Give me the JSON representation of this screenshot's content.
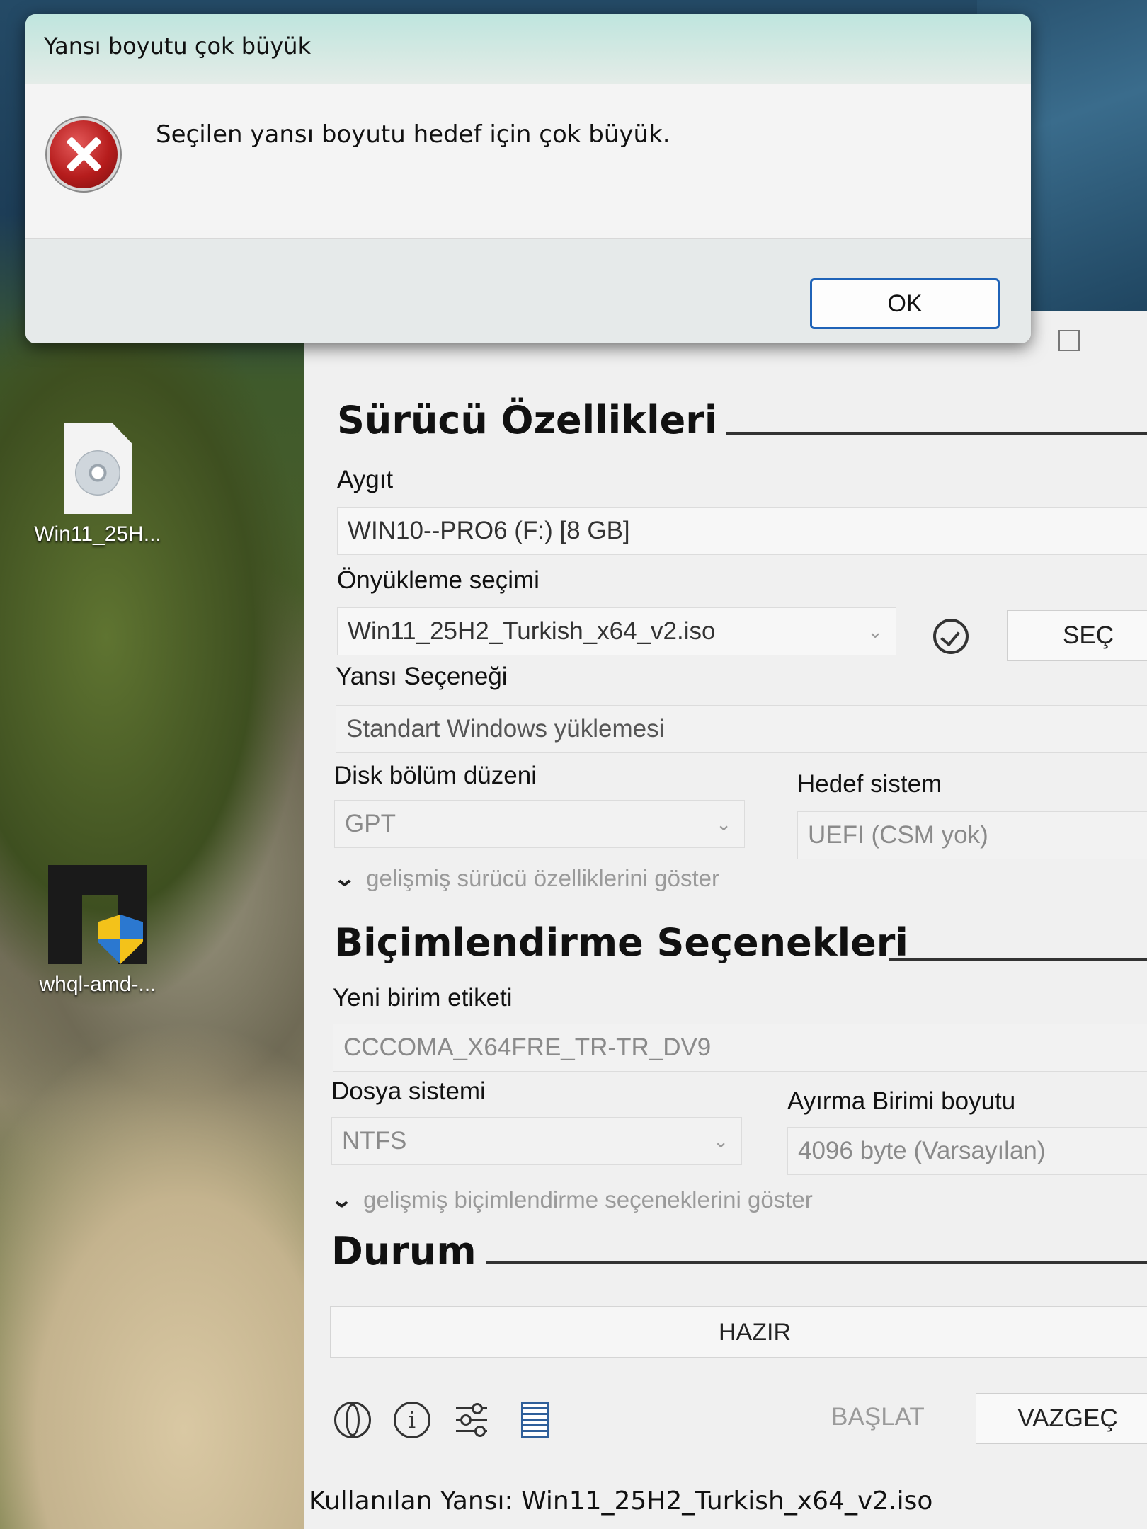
{
  "desktop": {
    "icons": [
      {
        "label": "Win11_25H...",
        "icon": "disc-image-file-icon"
      },
      {
        "label": "whql-amd-...",
        "icon": "amd-installer-icon"
      }
    ]
  },
  "dialog": {
    "title": "Yansı boyutu çok büyük",
    "message": "Seçilen yansı boyutu hedef için çok büyük.",
    "icon": "error-icon",
    "ok_label": "OK"
  },
  "drive_properties": {
    "section_title": "Sürücü Özellikleri",
    "device_label": "Aygıt",
    "device_value": "WIN10--PRO6 (F:) [8 GB]",
    "boot_selection_label": "Önyükleme seçimi",
    "boot_selection_value": "Win11_25H2_Turkish_x64_v2.iso",
    "select_button": "SEÇ",
    "image_option_label": "Yansı Seçeneği",
    "image_option_value": "Standart Windows yüklemesi",
    "partition_scheme_label": "Disk bölüm düzeni",
    "partition_scheme_value": "GPT",
    "target_system_label": "Hedef sistem",
    "target_system_value": "UEFI (CSM yok)",
    "advanced_toggle": "gelişmiş sürücü özelliklerini göster"
  },
  "format_options": {
    "section_title": "Biçimlendirme Seçenekleri",
    "volume_label_label": "Yeni birim etiketi",
    "volume_label_value": "CCCOMA_X64FRE_TR-TR_DV9",
    "file_system_label": "Dosya sistemi",
    "file_system_value": "NTFS",
    "cluster_size_label": "Ayırma Birimi boyutu",
    "cluster_size_value": "4096 byte (Varsayılan)",
    "advanced_toggle": "gelişmiş biçimlendirme seçeneklerini göster"
  },
  "status": {
    "section_title": "Durum",
    "status_text": "HAZIR"
  },
  "toolbar": {
    "icons": [
      "globe-icon",
      "info-icon",
      "settings-icon",
      "log-icon"
    ],
    "start_button": "BAŞLAT",
    "cancel_button": "VAZGEÇ"
  },
  "footer": {
    "text": "Kullanılan Yansı: Win11_25H2_Turkish_x64_v2.iso"
  },
  "colors": {
    "dialog_title_bg": "#bfe5de",
    "ok_button_border": "#1f63b8",
    "error_icon": "#b51c1c",
    "window_bg": "#f0f0f0"
  }
}
